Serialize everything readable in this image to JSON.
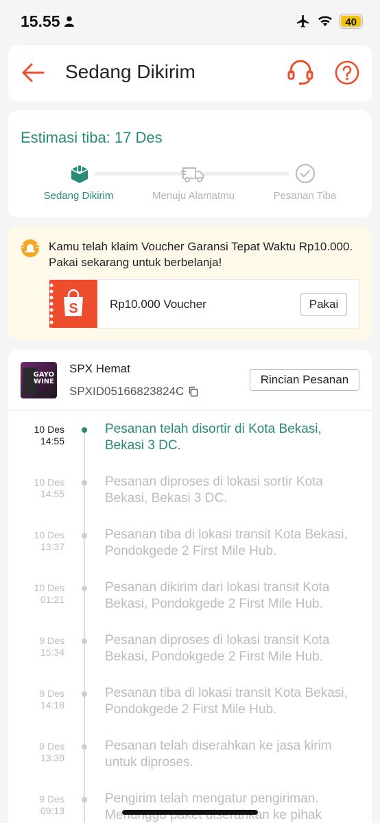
{
  "status_bar": {
    "time": "15.55",
    "battery": "40"
  },
  "header": {
    "title": "Sedang Dikirim"
  },
  "estimate": {
    "title": "Estimasi tiba: 17 Des",
    "steps": [
      {
        "label": "Sedang Dikirim",
        "active": true
      },
      {
        "label": "Menuju Alamatmu",
        "active": false
      },
      {
        "label": "Pesanan Tiba",
        "active": false
      }
    ]
  },
  "voucher": {
    "message": "Kamu telah klaim Voucher Garansi Tepat Waktu Rp10.000. Pakai sekarang untuk berbelanja!",
    "name": "Rp10.000 Voucher",
    "button": "Pakai",
    "ticket_logo": "S"
  },
  "shipment": {
    "courier": "SPX Hemat",
    "tracking_no": "SPXID05166823824C",
    "details_button": "Rincian Pesanan",
    "thumb_text_1": "GAYO",
    "thumb_text_2": "WINE"
  },
  "timeline": [
    {
      "date": "10 Des",
      "time": "14:55",
      "text": "Pesanan telah disortir di Kota Bekasi, Bekasi 3 DC.",
      "active": true
    },
    {
      "date": "10 Des",
      "time": "14:55",
      "text": "Pesanan diproses di lokasi sortir Kota Bekasi, Bekasi 3 DC.",
      "active": false
    },
    {
      "date": "10 Des",
      "time": "13:37",
      "text": "Pesanan tiba di lokasi transit Kota Bekasi, Pondokgede 2 First Mile Hub.",
      "active": false
    },
    {
      "date": "10 Des",
      "time": "01:21",
      "text": "Pesanan dikirim dari lokasi transit Kota Bekasi, Pondokgede 2 First Mile Hub.",
      "active": false
    },
    {
      "date": "9 Des",
      "time": "15:34",
      "text": "Pesanan diproses di lokasi transit Kota Bekasi, Pondokgede 2 First Mile Hub.",
      "active": false
    },
    {
      "date": "9 Des",
      "time": "14:18",
      "text": "Pesanan tiba di lokasi transit Kota Bekasi, Pondokgede 2 First Mile Hub.",
      "active": false
    },
    {
      "date": "9 Des",
      "time": "13:39",
      "text": "Pesanan telah diserahkan ke jasa kirim untuk diproses.",
      "active": false
    },
    {
      "date": "9 Des",
      "time": "09:13",
      "text": "Pengirim telah mengatur pengiriman. Menunggu paket diserahkan ke pihak",
      "active": false
    }
  ],
  "colors": {
    "accent": "#2a8a78",
    "brand": "#ee4d2d",
    "voucher_bg": "#fff9ea"
  }
}
